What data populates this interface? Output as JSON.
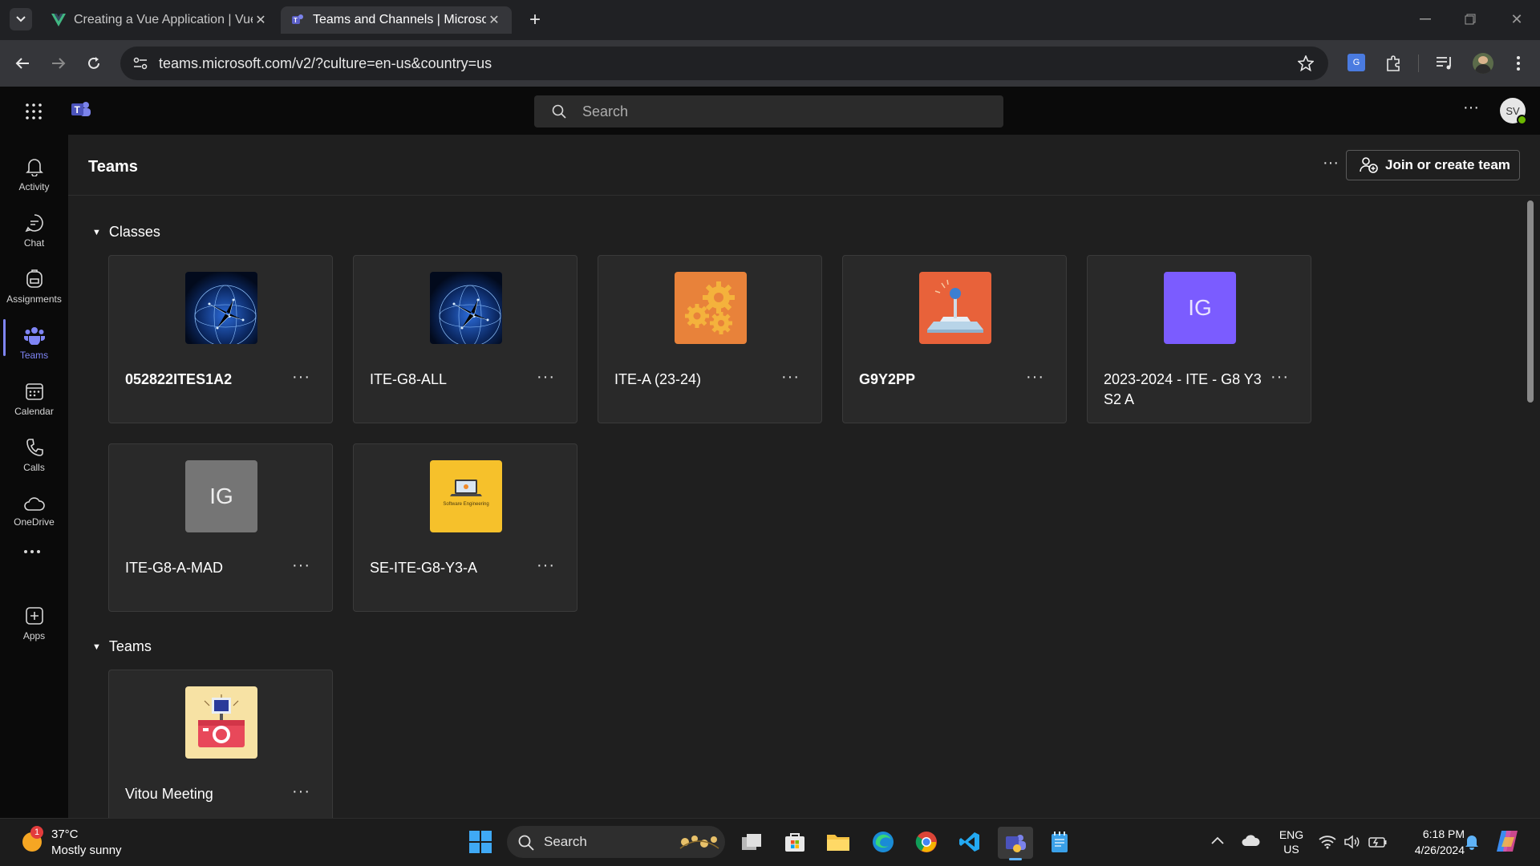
{
  "browser": {
    "tabs": [
      {
        "title": "Creating a Vue Application | Vue"
      },
      {
        "title": "Teams and Channels | Microsoft"
      }
    ],
    "url": "teams.microsoft.com/v2/?culture=en-us&country=us"
  },
  "app": {
    "search_placeholder": "Search",
    "avatar_initials": "SV"
  },
  "rail": [
    {
      "label": "Activity"
    },
    {
      "label": "Chat"
    },
    {
      "label": "Assignments"
    },
    {
      "label": "Teams"
    },
    {
      "label": "Calendar"
    },
    {
      "label": "Calls"
    },
    {
      "label": "OneDrive"
    },
    {
      "label": "Apps"
    }
  ],
  "main": {
    "title": "Teams",
    "join_button": "Join or create team",
    "sections": [
      {
        "label": "Classes",
        "cards": [
          {
            "name": "052822ITES1A2",
            "thumb": "globe-network"
          },
          {
            "name": "ITE-G8-ALL",
            "thumb": "globe-network"
          },
          {
            "name": "ITE-A (23-24)",
            "thumb": "gears"
          },
          {
            "name": "G9Y2PP",
            "thumb": "joystick"
          },
          {
            "name": "2023-2024 - ITE - G8 Y3 S2 A",
            "thumb": "IG"
          },
          {
            "name": "ITE-G8-A-MAD",
            "thumb": "IG"
          },
          {
            "name": "SE-ITE-G8-Y3-A",
            "thumb": "laptop"
          }
        ]
      },
      {
        "label": "Teams",
        "cards": [
          {
            "name": "Vitou Meeting",
            "thumb": "camera"
          }
        ]
      }
    ],
    "thumb_text": {
      "ig": "IG",
      "se_caption": "Software Engineering"
    }
  },
  "taskbar": {
    "weather_temp": "37°C",
    "weather_desc": "Mostly sunny",
    "weather_badge": "1",
    "search_label": "Search",
    "lang": "ENG",
    "region": "US",
    "time": "6:18 PM",
    "date": "4/26/2024"
  },
  "colors": {
    "accent": "#7f85f5",
    "ig_purple": "#7b5cff",
    "ig_gray": "#757575",
    "gears_bg": "#e8823a",
    "joystick_bg": "#e8623a",
    "laptop_bg": "#f6c12b",
    "camera_bg": "#f7e2a4"
  }
}
